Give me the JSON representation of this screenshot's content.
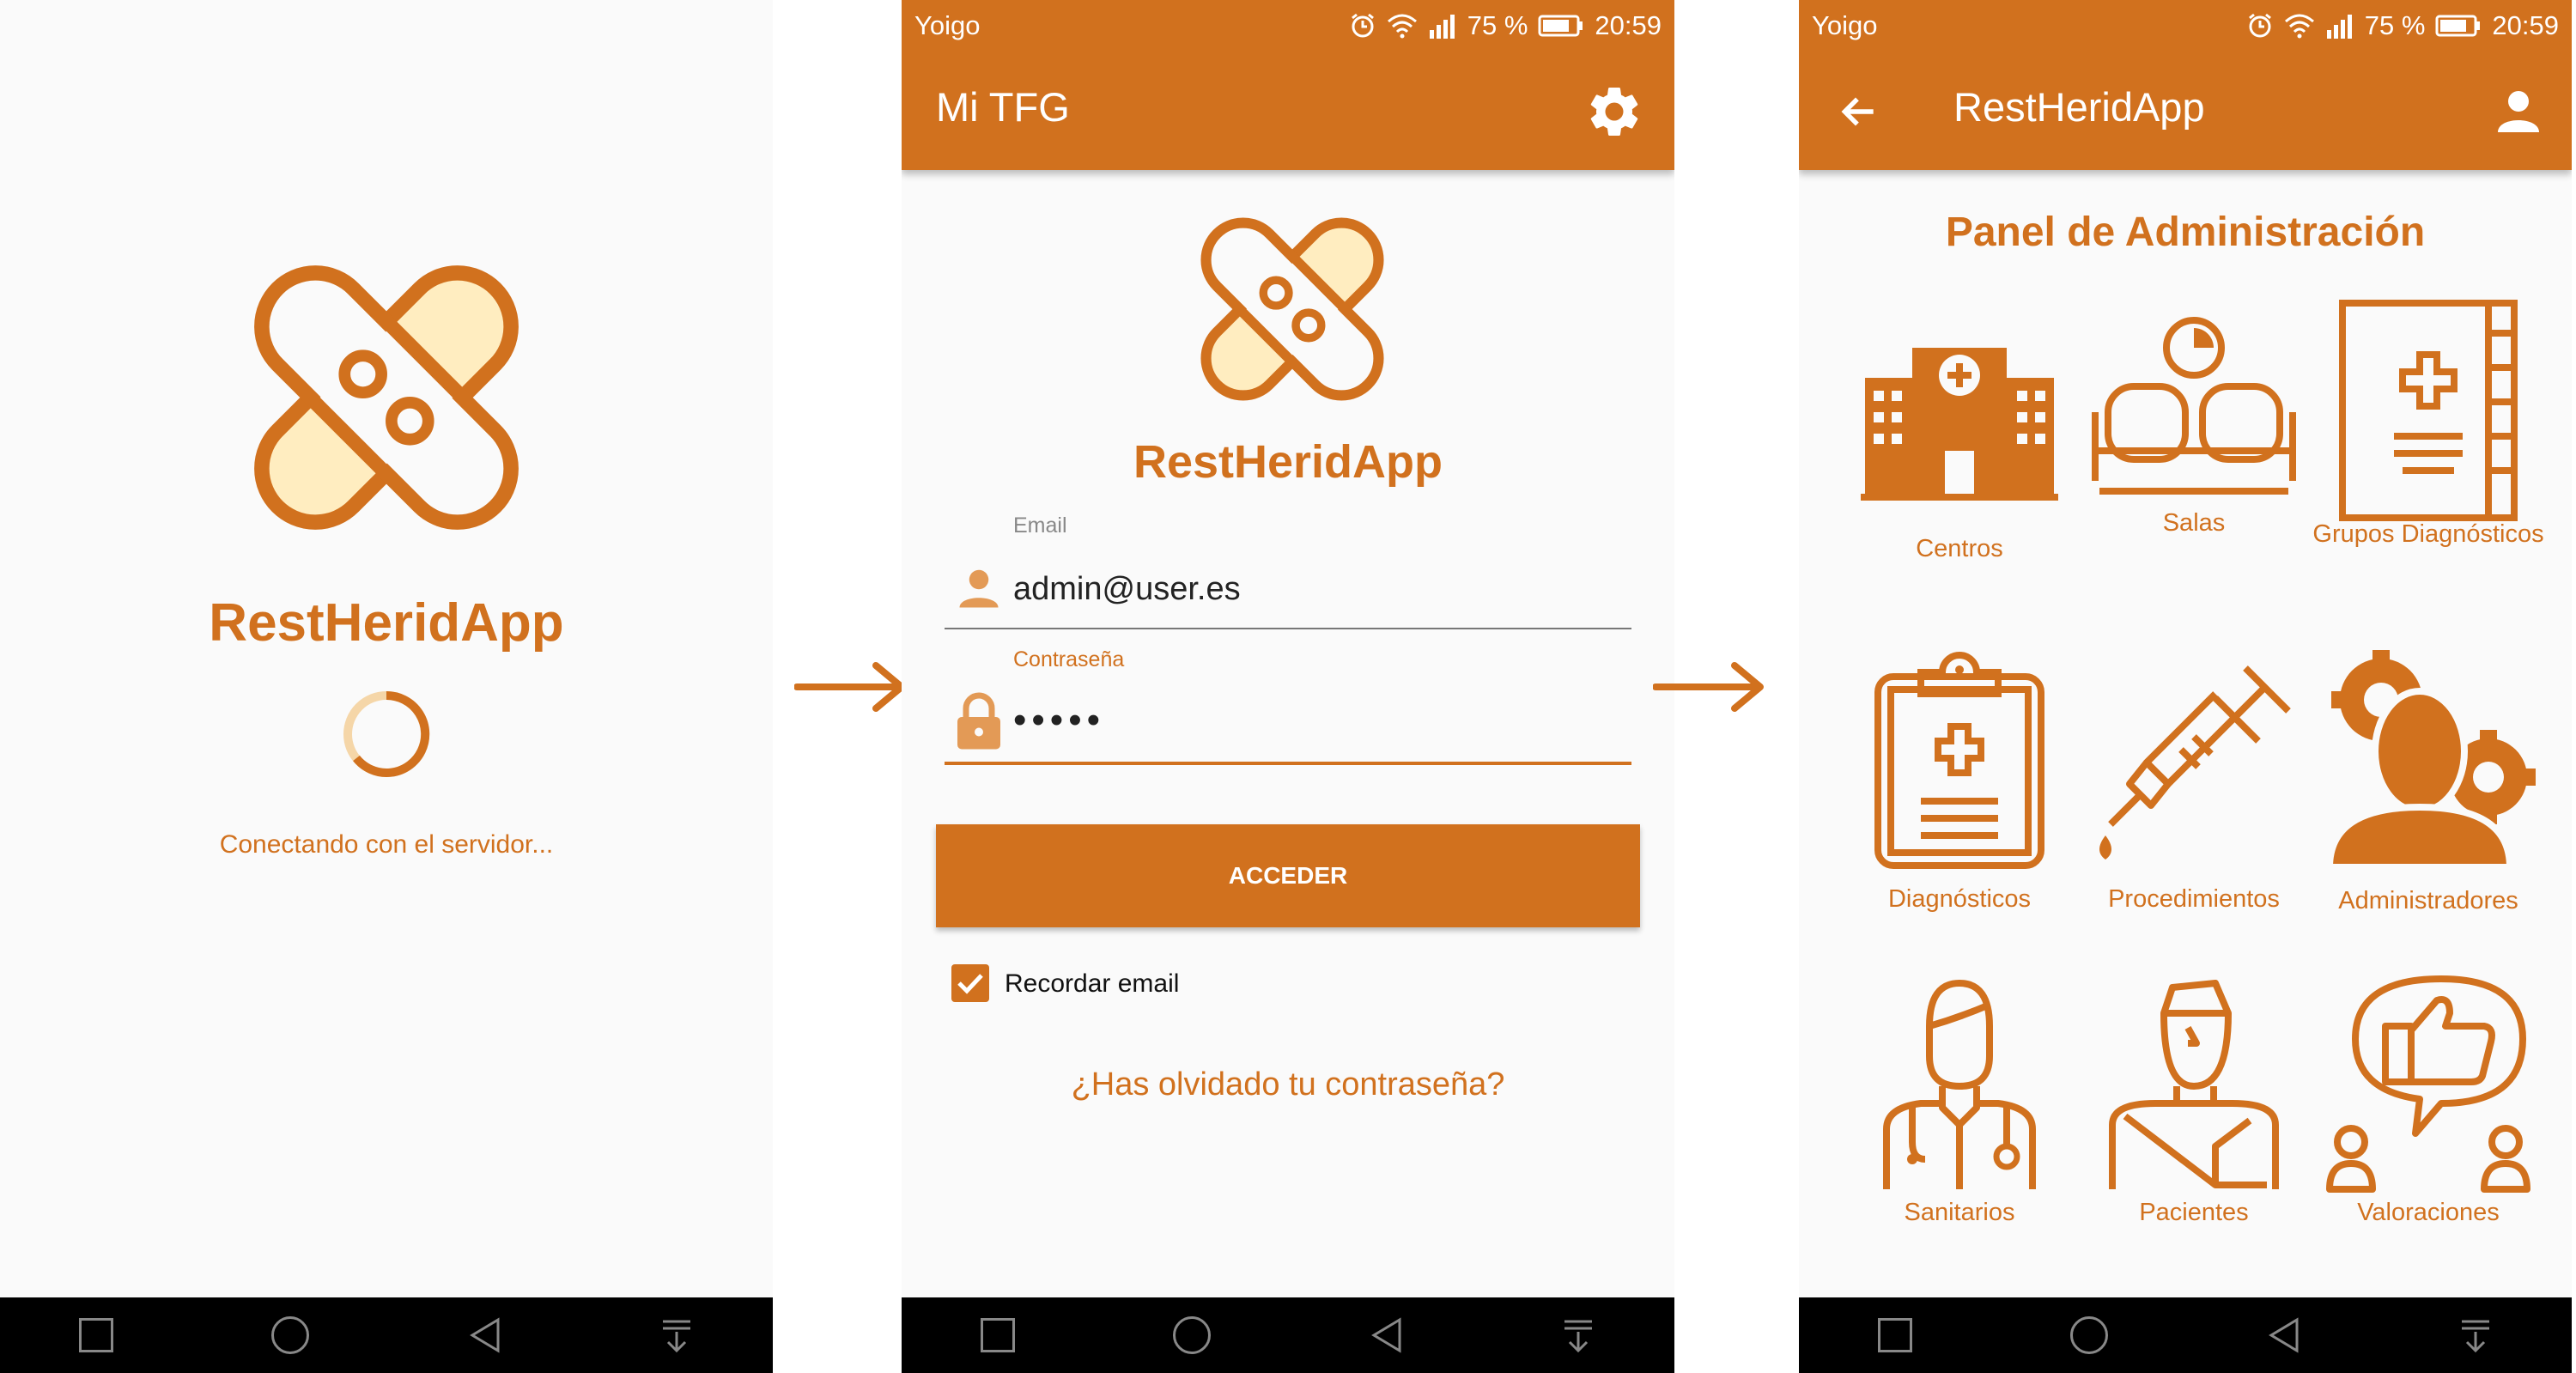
{
  "splash": {
    "app_name": "RestHeridApp",
    "status": "Conectando con el servidor..."
  },
  "status_bar": {
    "carrier": "Yoigo",
    "battery": "75 %",
    "time": "20:59"
  },
  "login": {
    "toolbar_title": "Mi TFG",
    "app_name": "RestHeridApp",
    "email_label": "Email",
    "email_value": "admin@user.es",
    "password_label": "Contraseña",
    "password_value": "•••••",
    "submit_label": "ACCEDER",
    "remember_label": "Recordar email",
    "remember_checked": true,
    "forgot_label": "¿Has olvidado tu contraseña?"
  },
  "admin": {
    "toolbar_title": "RestHeridApp",
    "heading": "Panel de Administración",
    "tiles": [
      {
        "label": "Centros",
        "icon": "hospital-icon"
      },
      {
        "label": "Salas",
        "icon": "waiting-room-icon"
      },
      {
        "label": "Grupos Diagnósticos",
        "icon": "medical-book-icon"
      },
      {
        "label": "Diagnósticos",
        "icon": "clipboard-icon"
      },
      {
        "label": "Procedimientos",
        "icon": "syringe-icon"
      },
      {
        "label": "Administradores",
        "icon": "admin-gear-icon"
      },
      {
        "label": "Sanitarios",
        "icon": "doctor-icon"
      },
      {
        "label": "Pacientes",
        "icon": "patient-icon"
      },
      {
        "label": "Valoraciones",
        "icon": "rating-icon"
      }
    ]
  },
  "colors": {
    "primary": "#d1711e",
    "logo_fill": "#ffedc0",
    "background": "#fafafa",
    "navbar": "#000000"
  }
}
